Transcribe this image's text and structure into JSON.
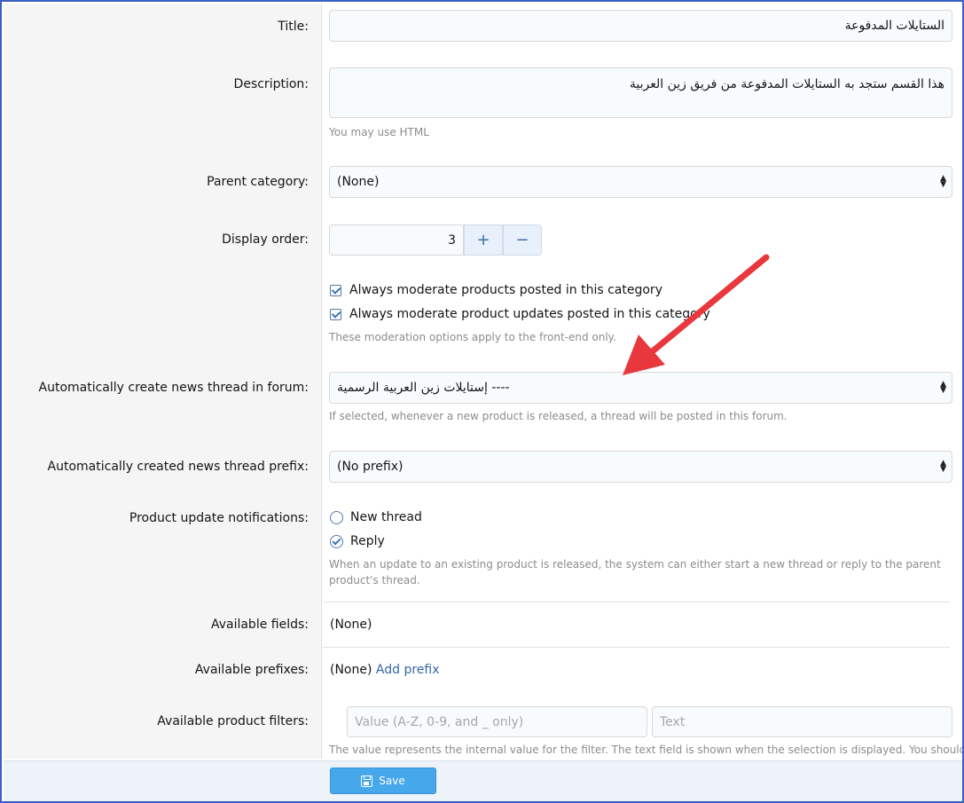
{
  "form": {
    "title": {
      "label": "Title:",
      "value": "الستايلات المدفوعة"
    },
    "description": {
      "label": "Description:",
      "value": "هذا القسم ستجد به الستايلات المدفوعة من فريق زين العربية",
      "hint": "You may use HTML"
    },
    "parent_category": {
      "label": "Parent category:",
      "value": "(None)"
    },
    "display_order": {
      "label": "Display order:",
      "value": "3",
      "plus": "+",
      "minus": "−"
    },
    "moderation": {
      "products": "Always moderate products posted in this category",
      "updates": "Always moderate product updates posted in this category",
      "hint": "These moderation options apply to the front-end only."
    },
    "news_forum": {
      "label": "Automatically create news thread in forum:",
      "value": "---- إستايلات زين العربية الرسمية",
      "hint": "If selected, whenever a new product is released, a thread will be posted in this forum."
    },
    "news_prefix": {
      "label": "Automatically created news thread prefix:",
      "value": "(No prefix)"
    },
    "update_notifications": {
      "label": "Product update notifications:",
      "options": [
        "New thread",
        "Reply"
      ],
      "selected": "Reply",
      "hint_line1": "When an update to an existing product is released, the system can either start a new thread or reply to the parent",
      "hint_line2": "product's thread."
    },
    "available_fields": {
      "label": "Available fields:",
      "value": "(None)"
    },
    "available_prefixes": {
      "label": "Available prefixes:",
      "value": "(None)",
      "link": "Add prefix"
    },
    "product_filters": {
      "label": "Available product filters:",
      "value_placeholder": "Value (A-Z, 0-9, and _ only)",
      "text_placeholder": "Text",
      "hint": "The value represents the internal value for the filter. The text field is shown when the selection is displayed. You should not"
    }
  },
  "footer": {
    "save_label": "Save"
  },
  "annotation": {
    "arrow_color": "#e8383d"
  }
}
